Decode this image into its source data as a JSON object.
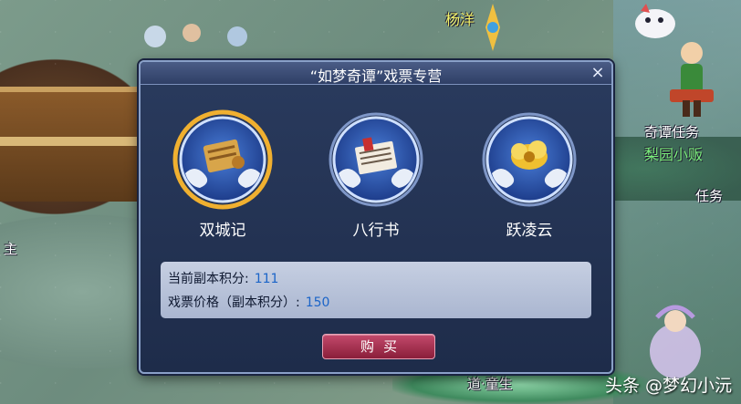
{
  "scene": {
    "npc_names": [
      {
        "text": "杨洋",
        "color": "yellow"
      },
      {
        "text": "奇谭任务",
        "color": "white"
      },
      {
        "text": "梨园小贩",
        "color": "green"
      },
      {
        "text": "任务",
        "color": "white"
      },
      {
        "text": "道·童生",
        "color": "white"
      },
      {
        "text": "主",
        "color": "white"
      }
    ]
  },
  "dialog": {
    "title": "“如梦奇谭”戏票专营",
    "close_symbol": "×",
    "items": [
      {
        "label": "双城记",
        "icon": "scroll-icon",
        "selected": true
      },
      {
        "label": "八行书",
        "icon": "letter-icon",
        "selected": false
      },
      {
        "label": "跃凌云",
        "icon": "golden-cloud-icon",
        "selected": false
      }
    ],
    "info": {
      "points_label": "当前副本积分:",
      "points_value": "111",
      "price_label": "戏票价格（副本积分）:",
      "price_value": "150"
    },
    "buy_label": "购买"
  },
  "watermark": "头条 @梦幻小沅",
  "colors": {
    "dialog_bg": "#1e2c4a",
    "accent_blue": "#1b64c8",
    "buy_button": "#a12a4a",
    "selected_ring": "#f0b030"
  }
}
